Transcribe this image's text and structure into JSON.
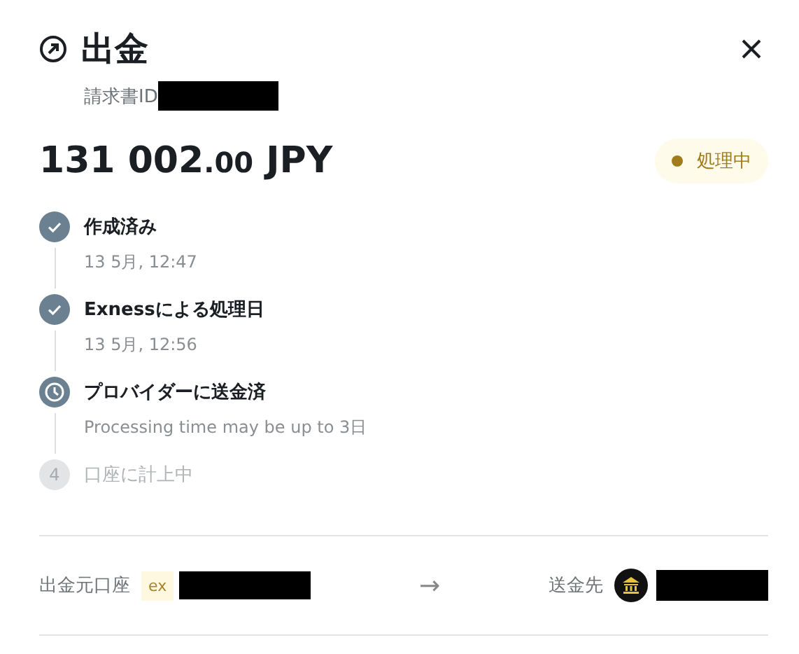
{
  "header": {
    "title": "出金",
    "invoice_label": "請求書ID"
  },
  "amount": {
    "whole": "131 002",
    "fraction": ".00",
    "currency": "JPY"
  },
  "status": {
    "label": "処理中",
    "color": "#a07c1c"
  },
  "steps": [
    {
      "kind": "done",
      "title": "作成済み",
      "detail": "13 5月, 12:47"
    },
    {
      "kind": "done",
      "title": "Exnessによる処理日",
      "detail": "13 5月, 12:56"
    },
    {
      "kind": "current",
      "title": "プロバイダーに送金済",
      "detail": "Processing time may be up to 3日"
    },
    {
      "kind": "pending",
      "number": "4",
      "title": "口座に計上中"
    }
  ],
  "transfer": {
    "from_label": "出金元口座",
    "from_logo": "ex",
    "arrow": "→",
    "to_label": "送金先"
  }
}
